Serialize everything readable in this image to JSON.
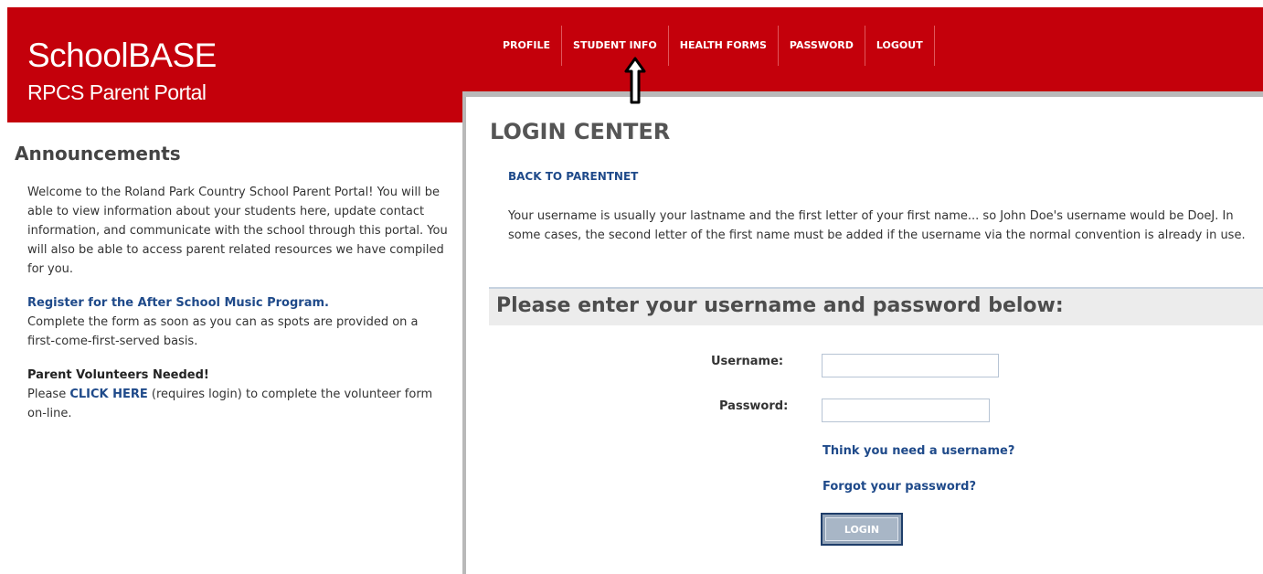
{
  "header": {
    "title": "SchoolBASE",
    "subtitle": "RPCS Parent Portal",
    "brand_color": "#c4000b"
  },
  "nav": {
    "items": [
      {
        "label": "PROFILE"
      },
      {
        "label": "STUDENT INFO"
      },
      {
        "label": "HEALTH FORMS"
      },
      {
        "label": "PASSWORD"
      },
      {
        "label": "LOGOUT"
      }
    ],
    "pointer_icon": "up-arrow-icon"
  },
  "announcements": {
    "title": "Announcements",
    "welcome": "Welcome to the Roland Park Country School Parent Portal! You will be able to view information about your students here, update contact information, and communicate with the school through this portal. You will also be able to access parent related resources we have compiled for you.",
    "register_link": "Register for the After School Music Program.",
    "register_text": "Complete the form as soon as you can as spots are provided on a first-come-first-served basis.",
    "volunteer_title": "Parent Volunteers Needed!",
    "volunteer_prefix": "Please",
    "volunteer_link": "CLICK HERE",
    "volunteer_suffix": "(requires login) to complete the volunteer form on-line."
  },
  "login": {
    "title": "LOGIN CENTER",
    "back_link": "BACK TO PARENTNET",
    "info": "Your username is usually your lastname and the first letter of your first name... so John Doe's username would be DoeJ. In some cases, the second letter of the first name must be added if the username via the normal convention is already in use.",
    "prompt": "Please enter your username and password below:",
    "username_label": "Username:",
    "username_value": "",
    "password_label": "Password:",
    "password_value": "",
    "need_username_link": "Think you need a username?",
    "forgot_password_link": "Forgot your password?",
    "login_button": "LOGIN"
  }
}
